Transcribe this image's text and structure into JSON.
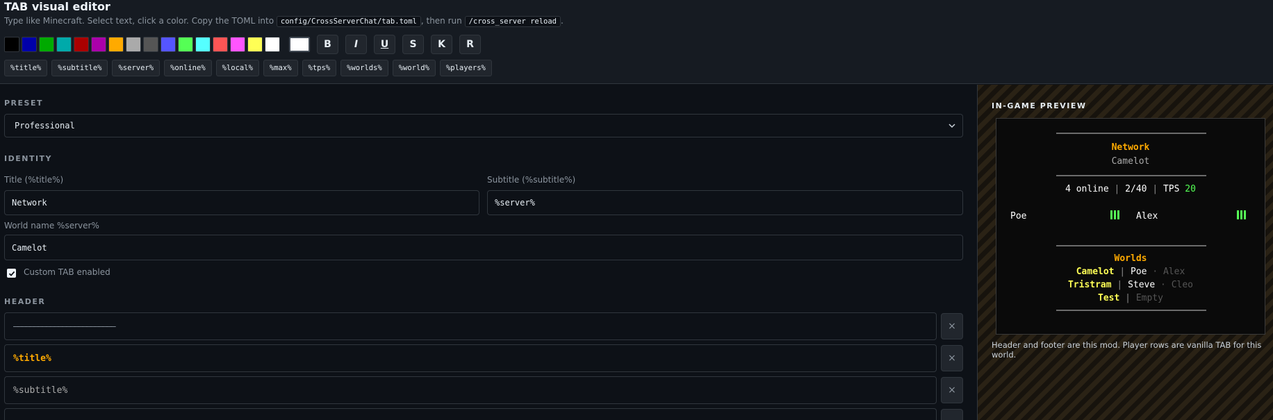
{
  "header": {
    "title": "TAB visual editor",
    "instructions": {
      "part1": "Type like Minecraft. Select text, click a color. Copy the TOML into ",
      "path": "config/CrossServerChat/tab.toml",
      "part2": ", then run ",
      "command": "/cross_server reload",
      "part3": "."
    }
  },
  "palette": {
    "colors": [
      "#000000",
      "#0000aa",
      "#00aa00",
      "#00aaaa",
      "#aa0000",
      "#aa00aa",
      "#ffaa00",
      "#aaaaaa",
      "#555555",
      "#5555ff",
      "#55ff55",
      "#55ffff",
      "#ff5555",
      "#ff55ff",
      "#ffff55",
      "#ffffff"
    ],
    "custom_color": "#ffffff",
    "format_buttons": [
      "B",
      "I",
      "U",
      "S",
      "K",
      "R"
    ]
  },
  "variables": [
    "%title%",
    "%subtitle%",
    "%server%",
    "%online%",
    "%local%",
    "%max%",
    "%tps%",
    "%worlds%",
    "%world%",
    "%players%"
  ],
  "form": {
    "preset": {
      "label": "PRESET",
      "value": "Professional"
    },
    "identity": {
      "label": "IDENTITY",
      "title_label": "Title (%title%)",
      "title_value": "Network",
      "subtitle_label": "Subtitle (%subtitle%)",
      "subtitle_value": "%server%",
      "world_label": "World name %server%",
      "world_value": "Camelot"
    },
    "custom_tab": {
      "label": "Custom TAB enabled",
      "checked": true
    },
    "header_section": {
      "label": "HEADER",
      "lines": [
        {
          "text": "—————————————————————————",
          "color": "#8b949e"
        },
        {
          "text": "%title%",
          "color": "#ffaa00"
        },
        {
          "text": "%subtitle%",
          "color": "#aaaaaa"
        }
      ],
      "remove_symbol": "×"
    }
  },
  "preview": {
    "title": "IN-GAME PREVIEW",
    "network": "Network",
    "server": "Camelot",
    "stats": {
      "online": "4 online",
      "sep": "|",
      "ratio": "2/40",
      "tps_label": "TPS",
      "tps_value": "20"
    },
    "players": [
      "Poe",
      "Alex"
    ],
    "worlds_heading": "Worlds",
    "worlds": [
      {
        "name": "Camelot",
        "sep": "|",
        "active": "Poe",
        "dot": "·",
        "idle": "Alex"
      },
      {
        "name": "Tristram",
        "sep": "|",
        "active": "Steve",
        "dot": "·",
        "idle": "Cleo"
      },
      {
        "name": "Test",
        "sep": "|",
        "active": "",
        "dot": "",
        "idle": "Empty"
      }
    ],
    "note": "Header and footer are this mod. Player rows are vanilla TAB for this world."
  }
}
